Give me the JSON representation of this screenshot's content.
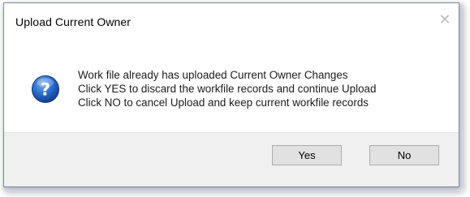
{
  "window": {
    "title": "Upload Current Owner",
    "close_glyph": "✕"
  },
  "icon": {
    "name": "question-icon",
    "glyph": "?",
    "color": "#1f5fbf"
  },
  "message": {
    "lines": [
      "Work file already has uploaded Current Owner Changes",
      "Click YES to discard the workfile records and continue Upload",
      "Click NO to cancel Upload and keep current workfile records"
    ]
  },
  "buttons": {
    "yes_label": "Yes",
    "no_label": "No"
  }
}
